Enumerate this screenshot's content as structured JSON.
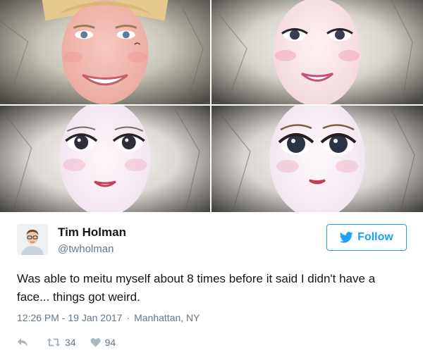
{
  "photos": [
    {
      "alt": "",
      "variant": 1
    },
    {
      "alt": "",
      "variant": 2
    },
    {
      "alt": "",
      "variant": 3
    },
    {
      "alt": "",
      "variant": 4
    }
  ],
  "author": {
    "name": "Tim Holman",
    "handle": "@twholman",
    "avatar_icon": "person-avatar"
  },
  "follow": {
    "label": "Follow",
    "icon": "twitter-bird-icon",
    "color": "#1da1f2"
  },
  "tweet": {
    "text": "Was able to meitu myself about 8 times before it said I didn't have a face... things got weird.",
    "timestamp": "12:26 PM - 19 Jan 2017",
    "separator": "·",
    "location": "Manhattan, NY"
  },
  "actions": {
    "reply_icon": "reply-icon",
    "retweet_icon": "retweet-icon",
    "retweets": "34",
    "like_icon": "heart-icon",
    "likes": "94"
  }
}
